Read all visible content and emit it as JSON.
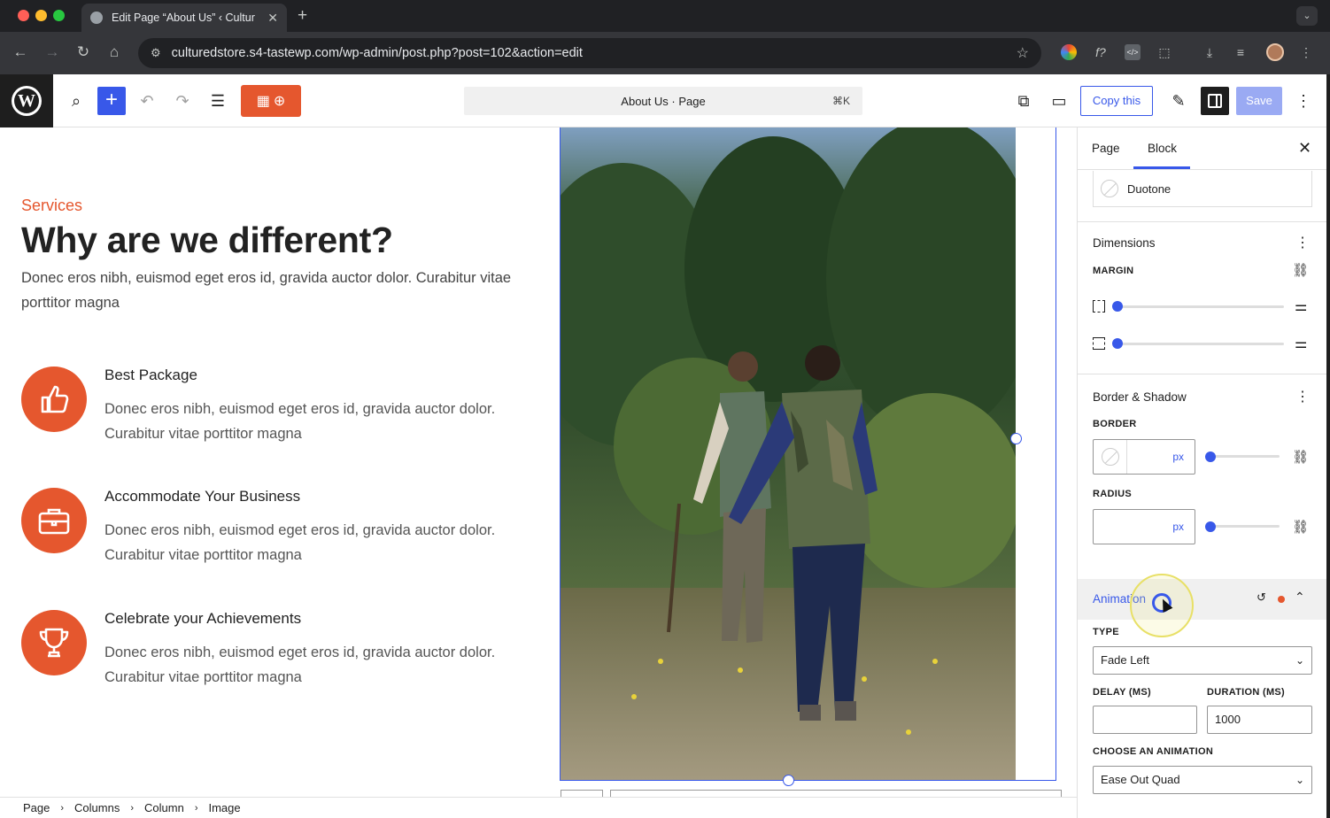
{
  "browser": {
    "tab_title": "Edit Page “About Us” ‹ Cultur",
    "tab_close": "✕",
    "new_tab": "+",
    "url": "culturedstore.s4-tastewp.com/wp-admin/post.php?post=102&action=edit",
    "ext_fn": "f?"
  },
  "wp_toolbar": {
    "document_title": "About Us · Page",
    "shortcut": "⌘K",
    "copy_label": "Copy this",
    "save_label": "Save"
  },
  "canvas": {
    "eyebrow": "Services",
    "heading": "Why are we different?",
    "intro": "Donec eros nibh, euismod eget eros id, gravida auctor dolor. Curabitur vitae porttitor magna",
    "features": [
      {
        "title": "Best Package",
        "desc": "Donec eros nibh, euismod eget eros id, gravida auctor dolor. Curabitur vitae porttitor magna",
        "icon": "thumbs-up-icon"
      },
      {
        "title": "Accommodate Your Business",
        "desc": "Donec eros nibh, euismod eget eros id, gravida auctor dolor. Curabitur vitae porttitor magna",
        "icon": "briefcase-icon"
      },
      {
        "title": "Celebrate your Achievements",
        "desc": "Donec eros nibh, euismod eget eros id, gravida auctor dolor. Curabitur vitae porttitor magna",
        "icon": "trophy-icon"
      }
    ],
    "accent_color": "#e5572e"
  },
  "breadcrumb": [
    "Page",
    "Columns",
    "Column",
    "Image"
  ],
  "inspector": {
    "tabs": [
      "Page",
      "Block"
    ],
    "active_tab": "Block",
    "duotone_label": "Duotone",
    "dimensions_title": "Dimensions",
    "margin_label": "MARGIN",
    "border_shadow_title": "Border & Shadow",
    "border_label": "BORDER",
    "border_unit": "px",
    "radius_label": "RADIUS",
    "radius_unit": "px",
    "animation_title": "Animation",
    "type_label": "TYPE",
    "type_value": "Fade Left",
    "delay_label": "DELAY (MS)",
    "delay_value": "",
    "duration_label": "DURATION (MS)",
    "duration_value": "1000",
    "easing_label": "CHOOSE AN ANIMATION",
    "easing_value": "Ease Out Quad"
  },
  "colors": {
    "wp_blue": "#3858e9",
    "accent_orange": "#e5572e"
  }
}
